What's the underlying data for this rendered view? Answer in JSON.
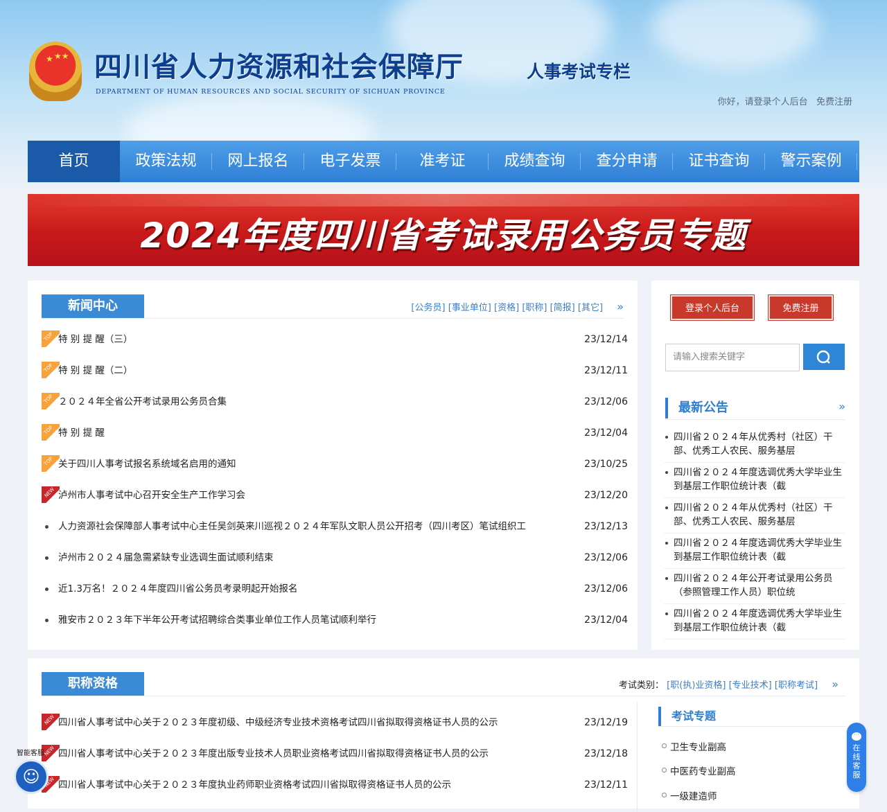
{
  "header": {
    "site_title": "四川省人力资源和社会保障厅",
    "site_subtitle": "DEPARTMENT OF HUMAN RESOURCES AND SOCIAL SECURITY OF SICHUAN PROVINCE",
    "column_title": "人事考试专栏",
    "greeting": "你好，请登录个人后台",
    "register": "免费注册"
  },
  "nav": [
    "首页",
    "政策法规",
    "网上报名",
    "电子发票",
    "准考证",
    "成绩查询",
    "查分申请",
    "证书查询",
    "警示案例"
  ],
  "banner": {
    "text": "2024年度四川省考试录用公务员专题"
  },
  "news": {
    "title": "新闻中心",
    "categories": [
      "[公务员]",
      "[事业单位]",
      "[资格]",
      "[职称]",
      "[简报]",
      "[其它]"
    ],
    "more": "»",
    "items": [
      {
        "tag": "TOP",
        "title": "特 别 提 醒（三）",
        "date": "23/12/14"
      },
      {
        "tag": "TOP",
        "title": "特 别 提 醒（二）",
        "date": "23/12/11"
      },
      {
        "tag": "TOP",
        "title": "２０２４年全省公开考试录用公务员合集",
        "date": "23/12/06"
      },
      {
        "tag": "TOP",
        "title": "特 别 提 醒",
        "date": "23/12/04"
      },
      {
        "tag": "TOP",
        "title": "关于四川人事考试报名系统域名启用的通知",
        "date": "23/10/25"
      },
      {
        "tag": "NEW",
        "title": "泸州市人事考试中心召开安全生产工作学习会",
        "date": "23/12/20"
      },
      {
        "tag": "",
        "title": "人力资源社会保障部人事考试中心主任吴剑英来川巡视２０２４年军队文职人员公开招考（四川考区）笔试组织工",
        "date": "23/12/13"
      },
      {
        "tag": "",
        "title": "泸州市２０２４届急需紧缺专业选调生面试顺利结束",
        "date": "23/12/06"
      },
      {
        "tag": "",
        "title": "近1.3万名！２０２４年度四川省公务员考录明起开始报名",
        "date": "23/12/06"
      },
      {
        "tag": "",
        "title": "雅安市２０２３年下半年公开考试招聘综合类事业单位工作人员笔试顺利举行",
        "date": "23/12/04"
      }
    ]
  },
  "side": {
    "login_button": "登录个人后台",
    "register_button": "免费注册",
    "search_placeholder": "请输入搜索关键字",
    "announce_title": "最新公告",
    "more": "»",
    "announcements": [
      "四川省２０２４年从优秀村（社区）干部、优秀工人农民、服务基层",
      "四川省２０２４年度选调优秀大学毕业生到基层工作职位统计表（截",
      "四川省２０２４年从优秀村（社区）干部、优秀工人农民、服务基层",
      "四川省２０２４年度选调优秀大学毕业生到基层工作职位统计表（截",
      "四川省２０２４年公开考试录用公务员（参照管理工作人员）职位统",
      "四川省２０２４年度选调优秀大学毕业生到基层工作职位统计表（截"
    ]
  },
  "titles": {
    "title": "职称资格",
    "category_label": "考试类别：",
    "categories": [
      "[职(执)业资格]",
      "[专业技术]",
      "[职称考试]"
    ],
    "more": "»",
    "items": [
      {
        "tag": "NEW",
        "title": "四川省人事考试中心关于２０２３年度初级、中级经济专业技术资格考试四川省拟取得资格证书人员的公示",
        "date": "23/12/19"
      },
      {
        "tag": "NEW",
        "title": "四川省人事考试中心关于２０２３年度出版专业技术人员职业资格考试四川省拟取得资格证书人员的公示",
        "date": "23/12/18"
      },
      {
        "tag": "NEW",
        "title": "四川省人事考试中心关于２０２３年度执业药师职业资格考试四川省拟取得资格证书人员的公示",
        "date": "23/12/11"
      }
    ],
    "topics_title": "考试专题",
    "topics": [
      "卫生专业副高",
      "中医药专业副高",
      "一级建造师"
    ]
  },
  "widgets": {
    "kefu": "在线客服",
    "bot_label": "智能客服"
  },
  "colors": {
    "nav": "#3a8ee6",
    "nav_active": "#1a5aa8",
    "banner": "#c8191a",
    "accent": "#2f7ed0"
  }
}
